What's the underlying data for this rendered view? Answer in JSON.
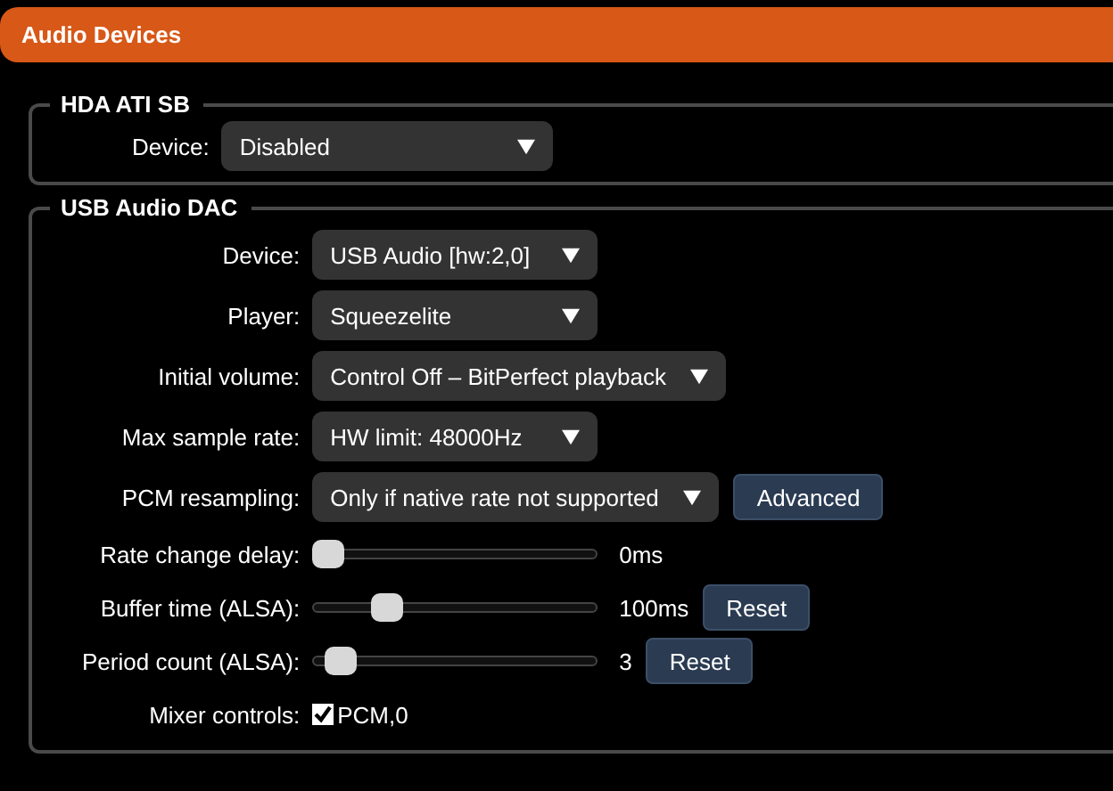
{
  "header": {
    "title": "Audio Devices"
  },
  "groups": [
    {
      "title": "HDA ATI SB",
      "rows": [
        {
          "kind": "select",
          "label": "Device:",
          "value": "Disabled"
        }
      ]
    },
    {
      "title": "USB Audio DAC",
      "rows": [
        {
          "kind": "select",
          "label": "Device:",
          "value": "USB Audio [hw:2,0]"
        },
        {
          "kind": "select",
          "label": "Player:",
          "value": "Squeezelite"
        },
        {
          "kind": "select",
          "label": "Initial volume:",
          "value": "Control Off – BitPerfect playback"
        },
        {
          "kind": "select",
          "label": "Max sample rate:",
          "value": "HW limit: 48000Hz"
        },
        {
          "kind": "select",
          "label": "PCM resampling:",
          "value": "Only if native rate not supported",
          "button": "Advanced"
        },
        {
          "kind": "slider",
          "label": "Rate change delay:",
          "level": 0,
          "reading": "0ms"
        },
        {
          "kind": "slider",
          "label": "Buffer time (ALSA):",
          "level": 0.23,
          "reading": "100ms",
          "button": "Reset"
        },
        {
          "kind": "slider",
          "label": "Period count (ALSA):",
          "level": 0.05,
          "reading": "3",
          "button": "Reset"
        },
        {
          "kind": "checkbox",
          "label": "Mixer controls:",
          "option": "PCM,0",
          "checked": true
        }
      ]
    }
  ]
}
